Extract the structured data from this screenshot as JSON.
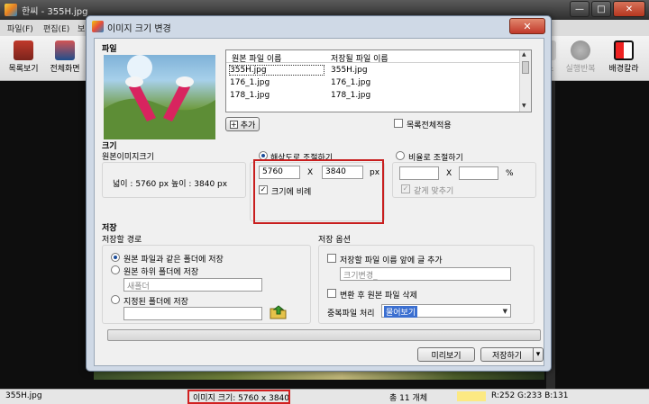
{
  "app": {
    "title": "한씨 - 355H.jpg",
    "window_buttons": {
      "minimize": "—",
      "maximize": "□",
      "close": "✕"
    },
    "menu": [
      "파일(F)",
      "편집(E)",
      "보"
    ],
    "toolbar": [
      {
        "label": "목록보기",
        "icon": "list-view-icon"
      },
      {
        "label": "전체화면",
        "icon": "fullscreen-icon"
      },
      {
        "label": "소",
        "icon": "partial-icon",
        "disabled": true
      },
      {
        "label": "실행반복",
        "icon": "repeat-icon",
        "disabled": true
      },
      {
        "label": "배경칼라",
        "icon": "background-color-icon"
      }
    ]
  },
  "dialog": {
    "title": "이미지 크기 변경",
    "close": "✕",
    "file_section": {
      "label": "파일",
      "columns": [
        "원본 파일 이름",
        "저장될 파일 이름"
      ],
      "rows": [
        [
          "355H.jpg",
          "355H.jpg"
        ],
        [
          "176_1.jpg",
          "176_1.jpg"
        ],
        [
          "178_1.jpg",
          "178_1.jpg"
        ]
      ],
      "add_button": "추가",
      "apply_all_label": "목록전체적용"
    },
    "size_section": {
      "label": "크기",
      "original_size_label": "원본이미지크기",
      "original_dims": "넓이 :   5760 px  높이 : 3840 px",
      "by_resolution_label": "해상도로 조절하기",
      "width_value": "5760",
      "x_sep": "X",
      "height_value": "3840",
      "unit": "px",
      "keep_ratio_label": "크기에 비례",
      "by_ratio_label": "비율로 조절하기",
      "ratio_x_sep": "X",
      "ratio_unit": "%",
      "same_fit_label": "같게 맞추기"
    },
    "save_section": {
      "label": "저장",
      "path_label": "저장할 경로",
      "same_folder_label": "원본 파일과 같은 폴더에 저장",
      "sub_folder_label": "원본 하위 폴더에 저장",
      "sub_folder_value": "새폴더",
      "custom_folder_label": "지정된 폴더에 저장",
      "custom_folder_value": "",
      "options_label": "저장 옵션",
      "prefix_label": "저장할 파일 이름 앞에 글 추가",
      "prefix_value": "크기변경_",
      "delete_original_label": "변환 후 원본 파일 삭제",
      "duplicate_label": "중복파일 처리",
      "duplicate_value": "물어보기"
    },
    "buttons": {
      "preview": "미리보기",
      "save": "저장하기",
      "save_arrow": "▾"
    }
  },
  "status": {
    "filename": "355H.jpg",
    "image_size": "이미지 크기: 5760 x 3840",
    "count": "총 11 개체",
    "color_swatch": "#fce983",
    "rgb": "R:252 G:233 B:131"
  },
  "colors": {
    "highlight": "#c81e1e",
    "selection": "#3b6fd0"
  }
}
